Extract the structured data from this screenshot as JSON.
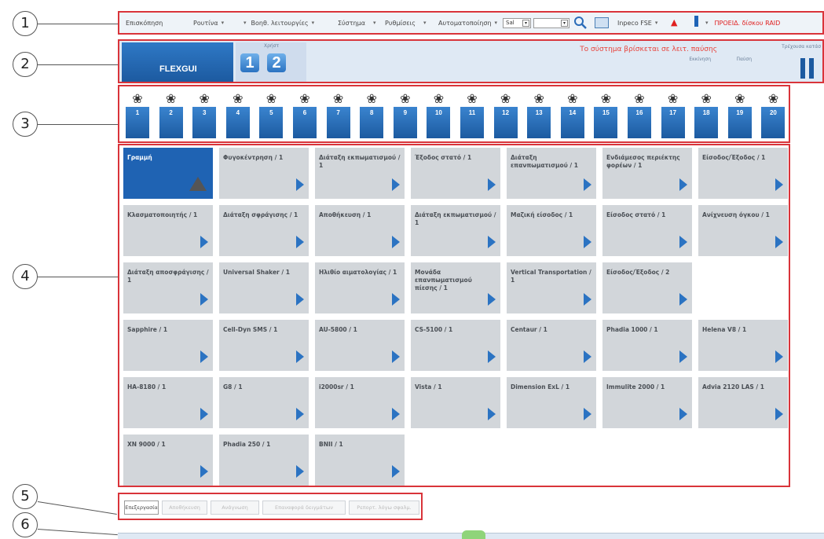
{
  "callouts": [
    "1",
    "2",
    "3",
    "4",
    "5",
    "6"
  ],
  "menu": {
    "items": [
      {
        "label": "Επισκόπηση",
        "caret": false
      },
      {
        "label": "Ρουτίνα",
        "caret": true
      },
      {
        "label": "Βοηθ. λειτουργίες",
        "caret": true
      },
      {
        "label": "Σύστημα",
        "caret": true
      },
      {
        "label": "Ρυθμίσεις",
        "caret": true
      },
      {
        "label": "Αυτοματοποίηση",
        "caret": true
      }
    ],
    "select_small": "Sal",
    "select_wide": "",
    "inpeco_label": "Inpeco FSE",
    "warning_text": "ΠΡΟΕΙΔ. δίσκου RAID"
  },
  "header": {
    "app_tab": "FLEXGUI",
    "users_label": "Χρήστ",
    "user_buttons": [
      "1",
      "2"
    ],
    "status_message": "Το σύστημα βρίσκεται σε λειτ. παύσης",
    "pause_label": "Παύση",
    "current_state_label": "Τρέχουσα κατάσ",
    "extra_label": "Εκκίνηση"
  },
  "racks": [
    "1",
    "2",
    "3",
    "4",
    "5",
    "6",
    "7",
    "8",
    "9",
    "10",
    "11",
    "12",
    "13",
    "14",
    "15",
    "16",
    "17",
    "18",
    "19",
    "20"
  ],
  "grid": {
    "rows": [
      [
        "Γραμμή",
        "Φυγοκέντρηση / 1",
        "Διάταξη εκπωματισμού / 1",
        "Έξοδος στατό / 1",
        "Διάταξη επανπωματισμού / 1",
        "Ενδιάμεσος περιέκτης φορέων / 1",
        "Είσοδος/Έξοδος / 1"
      ],
      [
        "Κλασματοποιητής / 1",
        "Διάταξη σφράγισης / 1",
        "Αποθήκευση / 1",
        "Διάταξη εκπωματισμού / 1",
        "Μαζική είσοδος / 1",
        "Είσοδος στατό / 1",
        "Ανίχνευση όγκου / 1"
      ],
      [
        "Διάταξη αποσφράγισης / 1",
        "Universal Shaker / 1",
        "Ηλιθίο αιματολογίας / 1",
        "Μονάδα επανπωματισμού πίεσης / 1",
        "Vertical Transportation / 1",
        "Είσοδος/Έξοδος / 2"
      ],
      [
        "Sapphire / 1",
        "Cell-Dyn SMS / 1",
        "AU-5800 / 1",
        "CS-5100 / 1",
        "Centaur / 1",
        "Phadia 1000 / 1",
        "Helena V8 / 1"
      ],
      [
        "HA-8180 / 1",
        "G8 / 1",
        "i2000sr / 1",
        "Vista / 1",
        "Dimension ExL / 1",
        "Immulite 2000 / 1",
        "Advia 2120 LAS / 1"
      ],
      [
        "XN 9000 / 1",
        "Phadia 250 / 1",
        "BNII / 1"
      ]
    ]
  },
  "bottom_tabs": [
    "Επεξεργασία",
    "Αποθήκευση",
    "Ανάγνωση",
    "Επαναφορά δειγμάτων",
    "Ρεπορτ. λόγω σφαλμ."
  ]
}
